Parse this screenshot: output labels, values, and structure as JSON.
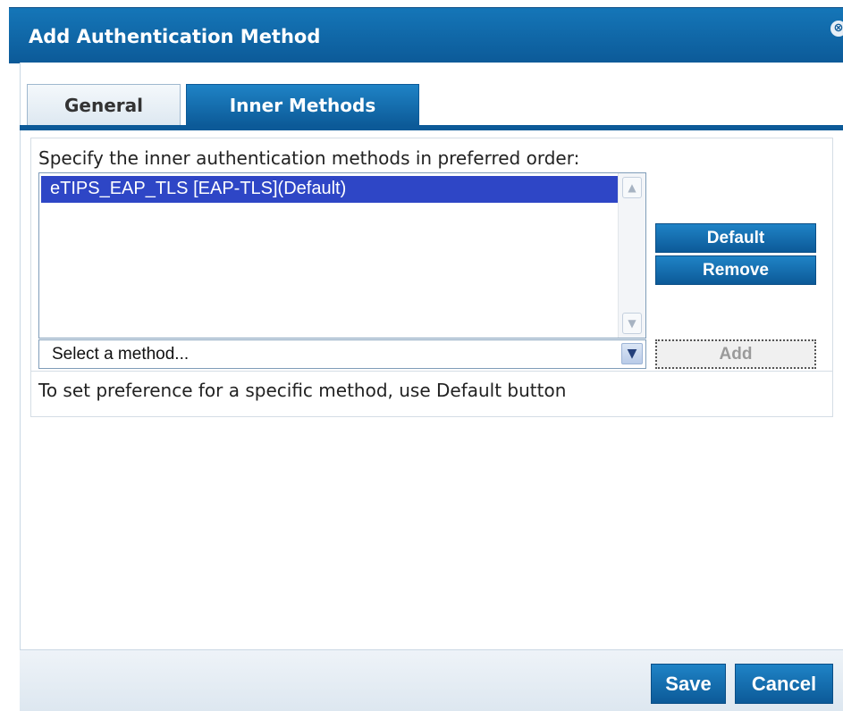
{
  "dialog": {
    "title": "Add Authentication Method",
    "close_glyph": "⊗"
  },
  "tabs": [
    {
      "label": "General",
      "active": false
    },
    {
      "label": "Inner Methods",
      "active": true
    }
  ],
  "inner_methods": {
    "instruction": "Specify the inner authentication methods in preferred order:",
    "list_items": [
      {
        "label": "eTIPS_EAP_TLS [EAP-TLS](Default)",
        "selected": true
      }
    ],
    "select": {
      "value": "Select a method..."
    },
    "buttons": {
      "default": "Default",
      "remove": "Remove",
      "add": "Add"
    },
    "hint": "To set preference for a specific method, use Default button"
  },
  "footer": {
    "save": "Save",
    "cancel": "Cancel"
  },
  "icons": {
    "scroll_up": "▲",
    "scroll_down": "▼",
    "dropdown": "▼"
  },
  "colors": {
    "accent": "#0c5a98",
    "selected_row": "#2e46c6"
  }
}
